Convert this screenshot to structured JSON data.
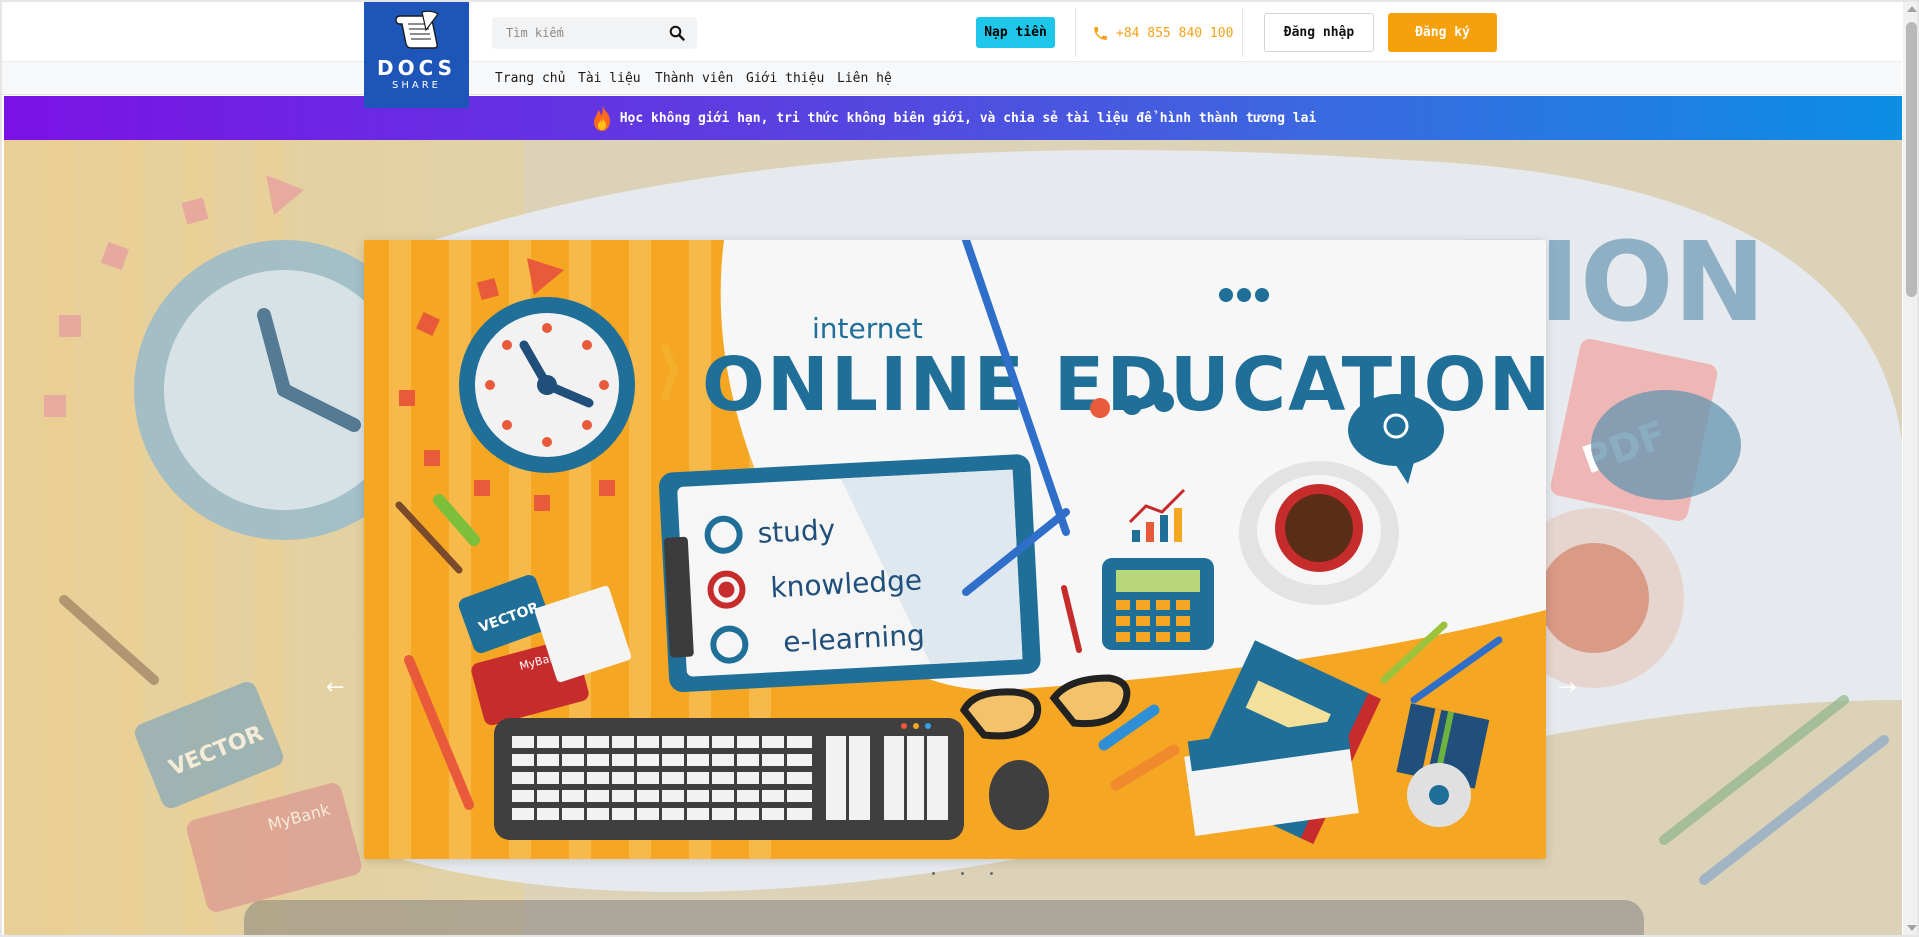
{
  "header": {
    "logo": {
      "line1": "DOCS",
      "line2": "SHARE"
    },
    "search": {
      "placeholder": "Tìm kiếm",
      "icon": "search-icon"
    },
    "topup_label": "Nạp tiền",
    "phone": "+84 855 840 100",
    "login_label": "Đăng nhập",
    "register_label": "Đăng ký"
  },
  "nav": {
    "items": [
      {
        "label": "Trang chủ"
      },
      {
        "label": "Tài liệu"
      },
      {
        "label": "Thành viên"
      },
      {
        "label": "Giới thiệu"
      },
      {
        "label": "Liên hệ"
      }
    ]
  },
  "announcement": {
    "icon": "fire-icon",
    "text": "Học không giới hạn, tri thức không biên giới, và chia sẻ tài liệu để hình thành tương lai"
  },
  "hero": {
    "prev_arrow": "←",
    "next_arrow": "→",
    "slide": {
      "overline": "internet",
      "title": "ONLINE EDUCATION",
      "checklist": [
        "study",
        "knowledge",
        "e-learning"
      ],
      "badge": "VECTOR",
      "card": "MyBank"
    },
    "background_title": "TION",
    "background_badge": "VECTOR",
    "background_card": "MyBank",
    "background_file": "PDF",
    "dots_count": 3
  },
  "colors": {
    "brand_blue": "#1d56b8",
    "topup_cyan": "#1ec6ea",
    "accent_orange": "#f6a00c",
    "slide_orange": "#f5a623",
    "slide_teal": "#1f6f99"
  }
}
